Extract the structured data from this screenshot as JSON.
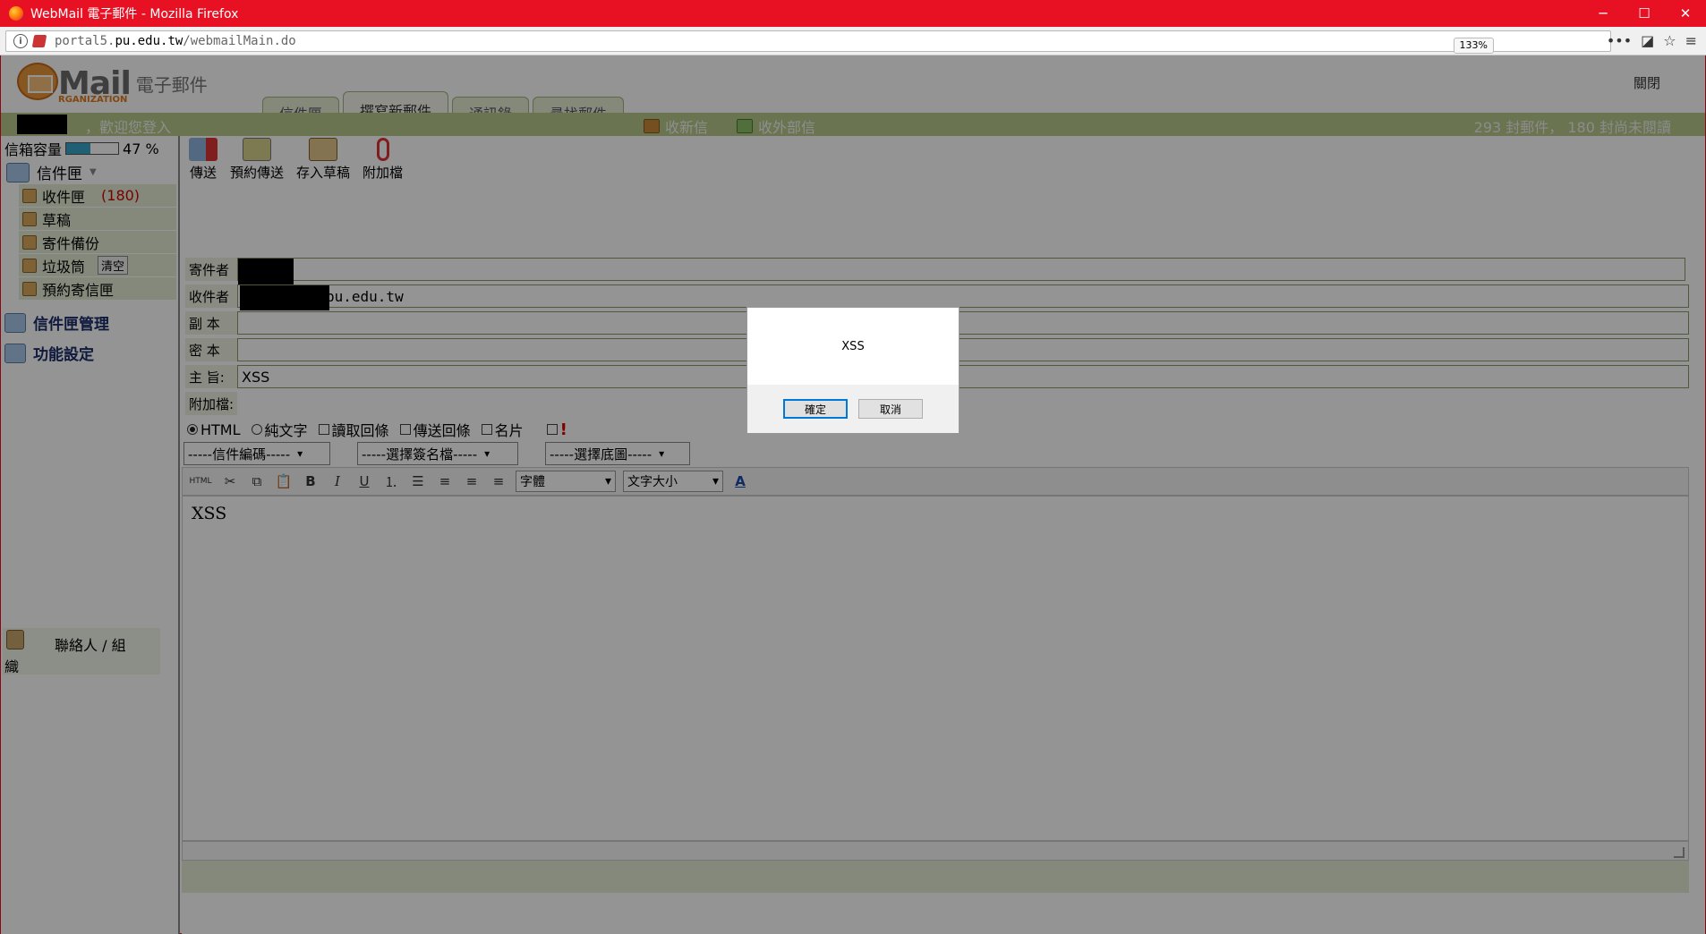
{
  "window": {
    "title": "WebMail 電子郵件 - Mozilla Firefox",
    "url_prefix": "portal5.",
    "url_domain": "pu.edu.tw",
    "url_path": "/webmailMain.do",
    "zoom": "133%"
  },
  "header": {
    "logo_text": "Mail",
    "logo_cn": "電子郵件",
    "logo_org": "RGANIZATION",
    "close_label": "關閉",
    "tabs": [
      {
        "label": "信件匣",
        "active": false
      },
      {
        "label": "撰寫新郵件",
        "active": true
      },
      {
        "label": "通訊錄",
        "active": false
      },
      {
        "label": "尋找郵件",
        "active": false
      }
    ],
    "welcome": "，歡迎您登入",
    "inbox_link": "收新信",
    "outside_link": "收外部信",
    "mail_count": "293 封郵件， 180 封尚未閱讀"
  },
  "sidebar": {
    "quota_label": "信箱容量",
    "quota_percent_text": "47 %",
    "quota_fraction": 0.47,
    "folder_head": "信件匣",
    "folders": [
      {
        "label": "收件匣",
        "count": "(180)"
      },
      {
        "label": "草稿"
      },
      {
        "label": "寄件備份"
      },
      {
        "label": "垃圾筒",
        "action": "清空"
      },
      {
        "label": "預約寄信匣"
      }
    ],
    "manage_label": "信件匣管理",
    "settings_label": "功能設定",
    "contacts_label": "聯絡人 / 組",
    "contacts_label2": "織"
  },
  "toolbar": {
    "send": "傳送",
    "schedule": "預約傳送",
    "save_draft": "存入草稿",
    "attach": "附加檔"
  },
  "fields": {
    "from_label": "寄件者",
    "to_label": "收件者",
    "to_value": "pu.edu.tw",
    "cc_label": "副 本",
    "bcc_label": "密 本",
    "subject_label": "主 旨:",
    "subject_value": "XSS",
    "attach_label": "附加檔:"
  },
  "options": {
    "html": "HTML",
    "plain": "純文字",
    "read_receipt": "讀取回條",
    "send_receipt": "傳送回條",
    "card": "名片",
    "important": "!"
  },
  "selects": {
    "encoding": "-----信件編碼-----",
    "signature": "-----選擇簽名檔-----",
    "background": "-----選擇底圖-----"
  },
  "editor": {
    "html_btn": "HTML",
    "font": "字體",
    "font_size": "文字大小",
    "body": "XSS"
  },
  "dialog": {
    "message": "XSS",
    "ok": "確定",
    "cancel": "取消"
  }
}
